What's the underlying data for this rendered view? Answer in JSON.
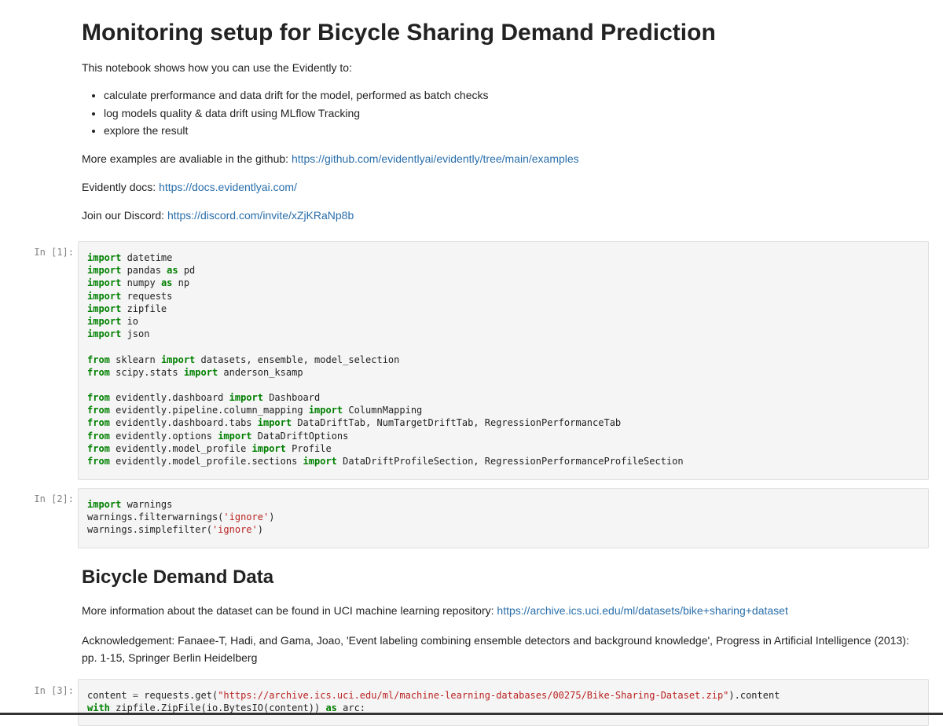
{
  "header": {
    "title": "Monitoring setup for Bicycle Sharing Demand Prediction",
    "intro": "This notebook shows how you can use the Evidently to:",
    "bullets": [
      "calculate prerformance and data drift for the model, performed as batch checks",
      "log models quality & data drift using MLflow Tracking",
      "explore the result"
    ],
    "examples_label": "More examples are avaliable in the github: ",
    "examples_link": "https://github.com/evidentlyai/evidently/tree/main/examples",
    "docs_label": "Evidently docs: ",
    "docs_link": "https://docs.evidentlyai.com/",
    "discord_label": "Join our Discord: ",
    "discord_link": "https://discord.com/invite/xZjKRaNp8b"
  },
  "cells": [
    {
      "prompt": "In [1]:",
      "lines": [
        [
          [
            "kw",
            "import"
          ],
          [
            "t",
            " datetime"
          ]
        ],
        [
          [
            "kw",
            "import"
          ],
          [
            "t",
            " pandas "
          ],
          [
            "kw",
            "as"
          ],
          [
            "t",
            " pd"
          ]
        ],
        [
          [
            "kw",
            "import"
          ],
          [
            "t",
            " numpy "
          ],
          [
            "kw",
            "as"
          ],
          [
            "t",
            " np"
          ]
        ],
        [
          [
            "kw",
            "import"
          ],
          [
            "t",
            " requests"
          ]
        ],
        [
          [
            "kw",
            "import"
          ],
          [
            "t",
            " zipfile"
          ]
        ],
        [
          [
            "kw",
            "import"
          ],
          [
            "t",
            " io"
          ]
        ],
        [
          [
            "kw",
            "import"
          ],
          [
            "t",
            " json"
          ]
        ],
        [],
        [
          [
            "kw",
            "from"
          ],
          [
            "t",
            " sklearn "
          ],
          [
            "kw",
            "import"
          ],
          [
            "t",
            " datasets, ensemble, model_selection"
          ]
        ],
        [
          [
            "kw",
            "from"
          ],
          [
            "t",
            " scipy.stats "
          ],
          [
            "kw",
            "import"
          ],
          [
            "t",
            " anderson_ksamp"
          ]
        ],
        [],
        [
          [
            "kw",
            "from"
          ],
          [
            "t",
            " evidently.dashboard "
          ],
          [
            "kw",
            "import"
          ],
          [
            "t",
            " Dashboard"
          ]
        ],
        [
          [
            "kw",
            "from"
          ],
          [
            "t",
            " evidently.pipeline.column_mapping "
          ],
          [
            "kw",
            "import"
          ],
          [
            "t",
            " ColumnMapping"
          ]
        ],
        [
          [
            "kw",
            "from"
          ],
          [
            "t",
            " evidently.dashboard.tabs "
          ],
          [
            "kw",
            "import"
          ],
          [
            "t",
            " DataDriftTab, NumTargetDriftTab, RegressionPerformanceTab"
          ]
        ],
        [
          [
            "kw",
            "from"
          ],
          [
            "t",
            " evidently.options "
          ],
          [
            "kw",
            "import"
          ],
          [
            "t",
            " DataDriftOptions"
          ]
        ],
        [
          [
            "kw",
            "from"
          ],
          [
            "t",
            " evidently.model_profile "
          ],
          [
            "kw",
            "import"
          ],
          [
            "t",
            " Profile"
          ]
        ],
        [
          [
            "kw",
            "from"
          ],
          [
            "t",
            " evidently.model_profile.sections "
          ],
          [
            "kw",
            "import"
          ],
          [
            "t",
            " DataDriftProfileSection, RegressionPerformanceProfileSection"
          ]
        ]
      ]
    },
    {
      "prompt": "In [2]:",
      "lines": [
        [
          [
            "kw",
            "import"
          ],
          [
            "t",
            " warnings"
          ]
        ],
        [
          [
            "t",
            "warnings.filterwarnings("
          ],
          [
            "str",
            "'ignore'"
          ],
          [
            "t",
            ")"
          ]
        ],
        [
          [
            "t",
            "warnings.simplefilter("
          ],
          [
            "str",
            "'ignore'"
          ],
          [
            "t",
            ")"
          ]
        ]
      ]
    },
    {
      "prompt": "In [3]:",
      "lines": [
        [
          [
            "t",
            "content "
          ],
          [
            "op",
            "="
          ],
          [
            "t",
            " requests.get("
          ],
          [
            "str",
            "\"https://archive.ics.uci.edu/ml/machine-learning-databases/00275/Bike-Sharing-Dataset.zip\""
          ],
          [
            "t",
            ").content"
          ]
        ],
        [
          [
            "kw",
            "with"
          ],
          [
            "t",
            " zipfile.ZipFile(io.BytesIO(content)) "
          ],
          [
            "kw",
            "as"
          ],
          [
            "t",
            " arc:"
          ]
        ]
      ]
    }
  ],
  "section2": {
    "title": "Bicycle Demand Data",
    "info_label": "More information about the dataset can be found in UCI machine learning repository: ",
    "info_link": "https://archive.ics.uci.edu/ml/datasets/bike+sharing+dataset",
    "ack": "Acknowledgement: Fanaee-T, Hadi, and Gama, Joao, 'Event labeling combining ensemble detectors and background knowledge', Progress in Artificial Intelligence (2013): pp. 1-15, Springer Berlin Heidelberg"
  }
}
